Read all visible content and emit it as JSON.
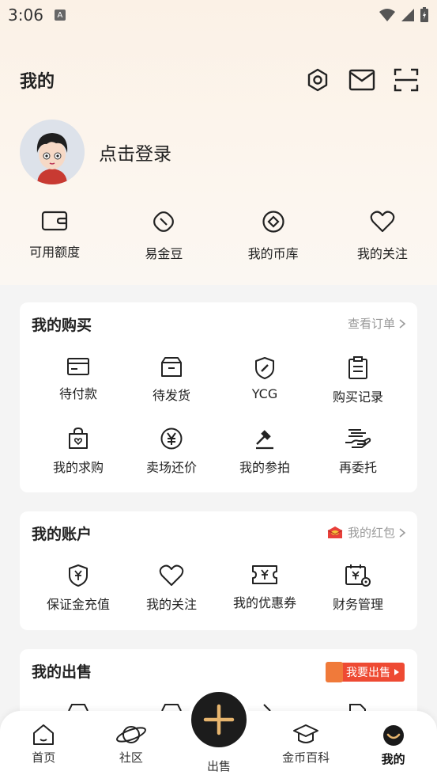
{
  "status_bar": {
    "time": "3:06",
    "notification_icon": "A"
  },
  "header": {
    "title": "我的"
  },
  "profile": {
    "login_text": "点击登录"
  },
  "quick": [
    {
      "label": "可用额度",
      "icon": "wallet-icon"
    },
    {
      "label": "易金豆",
      "icon": "bean-icon"
    },
    {
      "label": "我的币库",
      "icon": "coin-vault-icon"
    },
    {
      "label": "我的关注",
      "icon": "heart-icon"
    }
  ],
  "purchase": {
    "title": "我的购买",
    "link": "查看订单",
    "items": [
      {
        "label": "待付款",
        "icon": "card-icon"
      },
      {
        "label": "待发货",
        "icon": "box-icon"
      },
      {
        "label": "YCG",
        "icon": "shield-icon"
      },
      {
        "label": "购买记录",
        "icon": "clipboard-icon"
      },
      {
        "label": "我的求购",
        "icon": "bag-heart-icon"
      },
      {
        "label": "卖场还价",
        "icon": "yen-circle-icon"
      },
      {
        "label": "我的参拍",
        "icon": "gavel-icon"
      },
      {
        "label": "再委托",
        "icon": "hand-icon"
      }
    ]
  },
  "account": {
    "title": "我的账户",
    "link": "我的红包",
    "items": [
      {
        "label": "保证金充值",
        "icon": "shield-yen-icon"
      },
      {
        "label": "我的关注",
        "icon": "heart-icon"
      },
      {
        "label": "我的优惠券",
        "icon": "coupon-icon"
      },
      {
        "label": "财务管理",
        "icon": "finance-icon"
      }
    ]
  },
  "sale": {
    "title": "我的出售",
    "badge": "我要出售"
  },
  "tabbar": {
    "tabs": [
      {
        "label": "首页",
        "icon": "home-icon"
      },
      {
        "label": "社区",
        "icon": "planet-icon"
      },
      {
        "label": "出售",
        "icon": "plus-icon"
      },
      {
        "label": "金币百科",
        "icon": "graduation-cap-icon"
      },
      {
        "label": "我的",
        "icon": "smile-icon"
      }
    ]
  },
  "colors": {
    "accent": "#e7b56e",
    "badge": "#ee4a33",
    "text": "#222222"
  }
}
